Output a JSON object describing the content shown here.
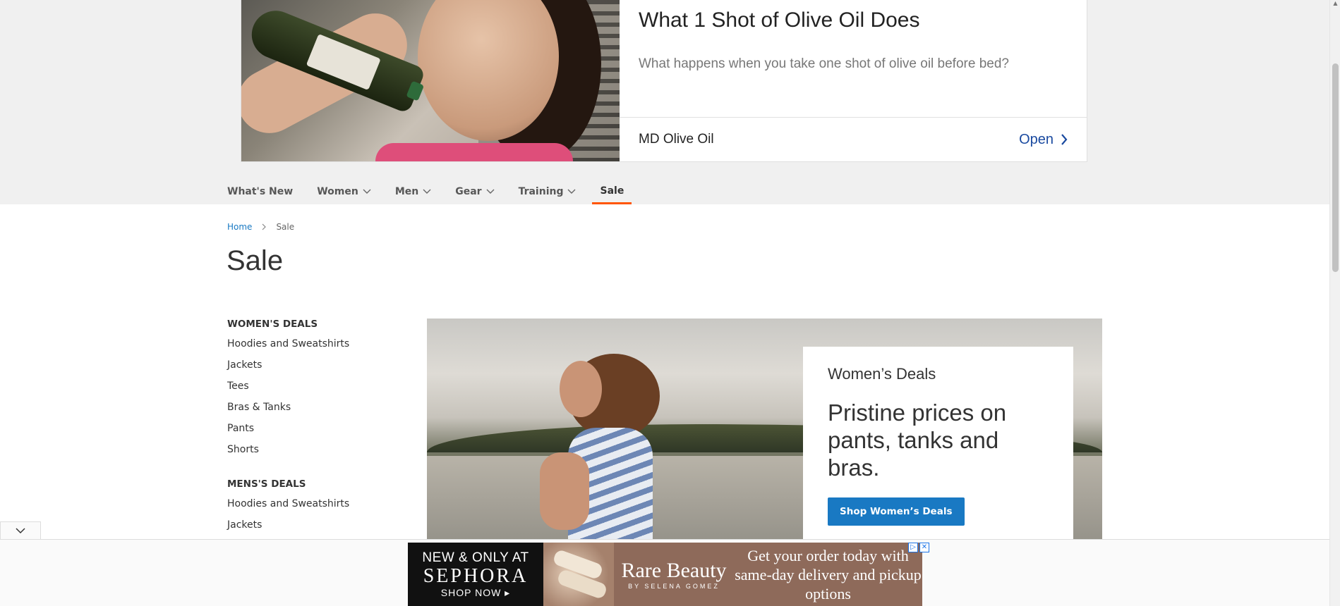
{
  "top_ad": {
    "title": "What 1 Shot of Olive Oil Does",
    "description": "What happens when you take one shot of olive oil before bed?",
    "brand": "MD Olive Oil",
    "cta": "Open"
  },
  "nav": {
    "items": [
      {
        "label": "What's New"
      },
      {
        "label": "Women"
      },
      {
        "label": "Men"
      },
      {
        "label": "Gear"
      },
      {
        "label": "Training"
      },
      {
        "label": "Sale"
      }
    ]
  },
  "breadcrumb": {
    "home": "Home",
    "current": "Sale"
  },
  "page_title": "Sale",
  "sidebar": {
    "womens": {
      "heading": "WOMEN'S DEALS",
      "items": [
        "Hoodies and Sweatshirts",
        "Jackets",
        "Tees",
        "Bras & Tanks",
        "Pants",
        "Shorts"
      ]
    },
    "mens": {
      "heading": "MENS'S DEALS",
      "items": [
        "Hoodies and Sweatshirts",
        "Jackets"
      ]
    }
  },
  "hero": {
    "kicker": "Women’s Deals",
    "title": "Pristine prices on pants, tanks and bras.",
    "button": "Shop Women’s Deals"
  },
  "bottom_ad": {
    "sephora_line1": "NEW & ONLY AT",
    "sephora_line2": "SEPHORA",
    "sephora_line3": "SHOP NOW ▸",
    "brand_name": "Rare Beauty",
    "brand_sub": "BY SELENA GOMEZ",
    "message": "Get your order today with same-day delivery and pickup options"
  },
  "colors": {
    "accent": "#1979c3",
    "nav_active": "#ff5501"
  }
}
